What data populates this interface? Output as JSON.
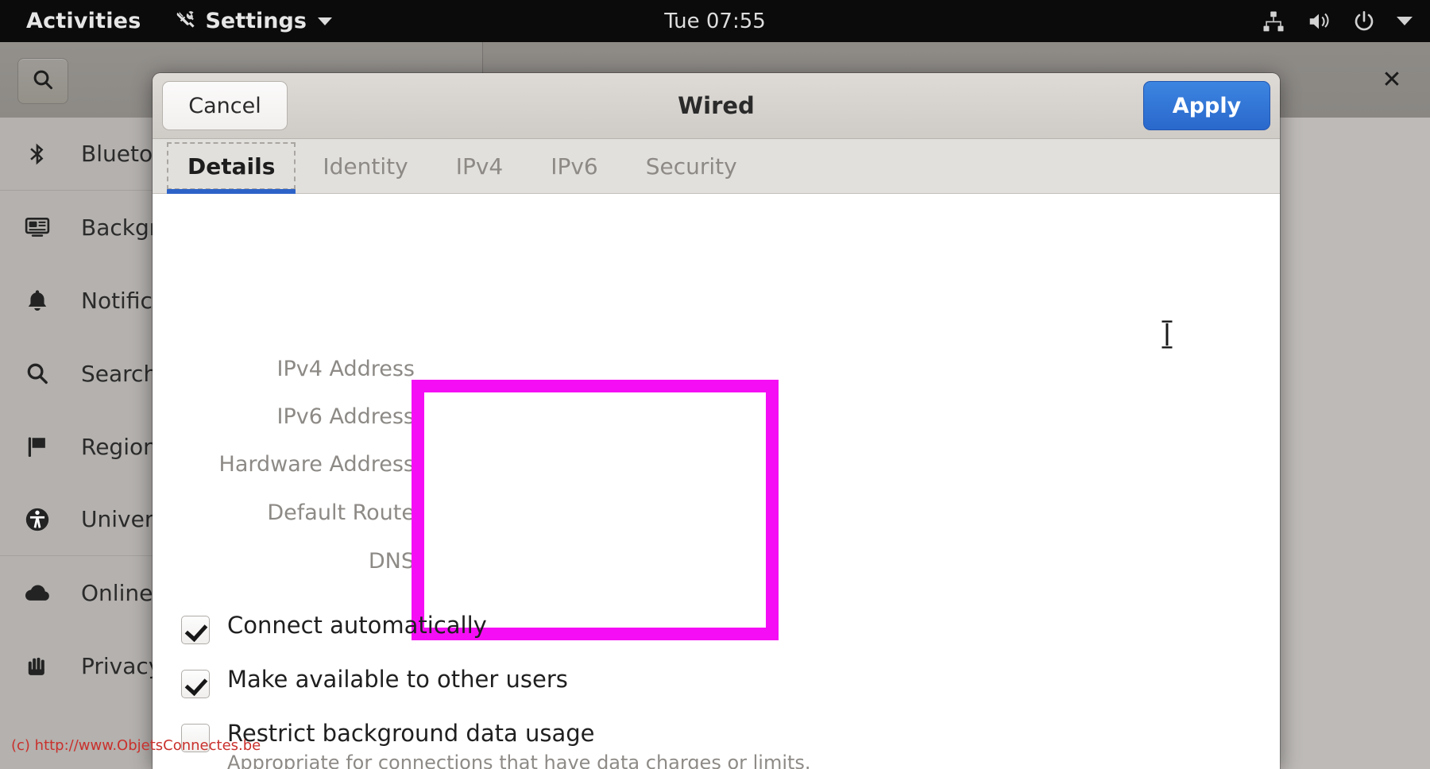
{
  "topbar": {
    "activities": "Activities",
    "app_menu": "Settings",
    "app_icon": "tools-icon",
    "clock": "Tue 07:55",
    "status_icons": [
      "network-wired-icon",
      "volume-high-icon",
      "power-icon",
      "chevron-down-icon"
    ]
  },
  "settings_window": {
    "search_icon": "search-icon",
    "close_label": "✕",
    "sidebar": {
      "items": [
        {
          "label": "Bluetooth",
          "icon": "bluetooth-icon",
          "separator_below": true
        },
        {
          "label": "Background",
          "icon": "background-icon",
          "separator_below": false
        },
        {
          "label": "Notifications",
          "icon": "bell-icon",
          "separator_below": false
        },
        {
          "label": "Search",
          "icon": "search-icon",
          "separator_below": false
        },
        {
          "label": "Region",
          "icon": "flag-icon",
          "separator_below": false
        },
        {
          "label": "Universal Access",
          "icon": "accessibility-icon",
          "separator_below": true
        },
        {
          "label": "Online Accounts",
          "icon": "cloud-icon",
          "separator_below": false
        },
        {
          "label": "Privacy",
          "icon": "hand-icon",
          "separator_below": false
        }
      ]
    }
  },
  "dialog": {
    "title": "Wired",
    "cancel_label": "Cancel",
    "apply_label": "Apply",
    "accent_color": "#2d63c8",
    "highlight_color": "#f50ef5",
    "tabs": [
      {
        "label": "Details",
        "active": true
      },
      {
        "label": "Identity",
        "active": false
      },
      {
        "label": "IPv4",
        "active": false
      },
      {
        "label": "IPv6",
        "active": false
      },
      {
        "label": "Security",
        "active": false
      }
    ],
    "details": {
      "fields": [
        {
          "label": "IPv4 Address",
          "value": ""
        },
        {
          "label": "IPv6 Address",
          "value": ""
        },
        {
          "label": "Hardware Address",
          "value": ""
        },
        {
          "label": "Default Route",
          "value": ""
        },
        {
          "label": "DNS",
          "value": ""
        }
      ],
      "options": [
        {
          "label": "Connect automatically",
          "checked": true,
          "sub": ""
        },
        {
          "label": "Make available to other users",
          "checked": true,
          "sub": ""
        },
        {
          "label": "Restrict background data usage",
          "checked": false,
          "sub": "Appropriate for connections that have data charges or limits."
        }
      ]
    }
  },
  "watermark": "(c) http://www.ObjetsConnectes.be"
}
